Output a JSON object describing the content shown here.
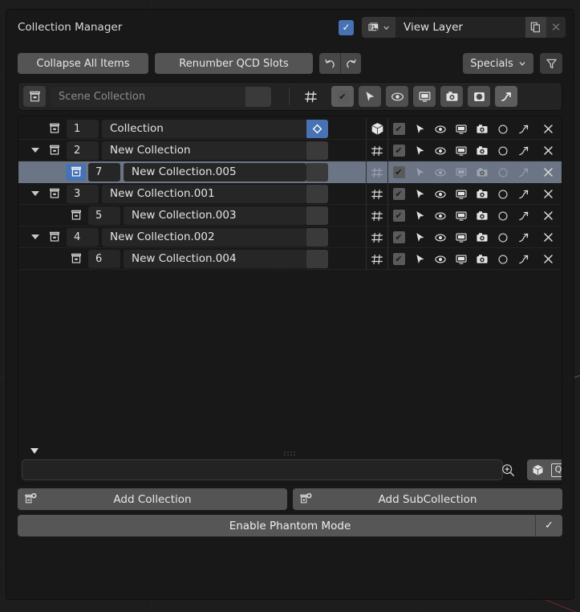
{
  "window": {
    "title": "Collection Manager",
    "enabled_checkbox": true,
    "view_layer": {
      "icon": "render-layers-icon",
      "value": "View Layer",
      "copy_label": "copy-icon",
      "close_label": "✕"
    }
  },
  "toolbar": {
    "collapse_label": "Collapse All Items",
    "renumber_label": "Renumber QCD Slots",
    "undo_icon": "undo-icon",
    "redo_icon": "redo-icon",
    "specials_label": "Specials",
    "filter_icon": "filter-icon"
  },
  "scene_collection": {
    "icon": "collection-icon",
    "name": "Scene Collection",
    "placeholder": "Scene Collection",
    "qcd_icon": "qcd-slot-icon",
    "toggles": [
      {
        "name": "exclude-toggle",
        "icon": "checkbox",
        "on": true
      },
      {
        "name": "selectable-toggle",
        "icon": "cursor",
        "on": false
      },
      {
        "name": "hide-viewport-toggle",
        "icon": "eye",
        "on": false
      },
      {
        "name": "disable-viewport-toggle",
        "icon": "monitor",
        "on": false
      },
      {
        "name": "disable-render-toggle",
        "icon": "camera",
        "on": false
      },
      {
        "name": "holdout-toggle",
        "icon": "holdout",
        "on": false
      },
      {
        "name": "indirect-only-toggle",
        "icon": "indirect",
        "on": true
      }
    ]
  },
  "tree": {
    "rows": [
      {
        "indent": 0,
        "expander": false,
        "number": "1",
        "name": "Collection",
        "icon_active": false,
        "swatch": "blue",
        "row_icon": "object-cube",
        "selected": false,
        "dim": false
      },
      {
        "indent": 0,
        "expander": true,
        "number": "2",
        "name": "New Collection",
        "icon_active": false,
        "swatch": "grey",
        "row_icon": "qcd-slot",
        "selected": false,
        "dim": false
      },
      {
        "indent": 1,
        "expander": false,
        "number": "7",
        "name": "New Collection.005",
        "icon_active": true,
        "swatch": "grey",
        "row_icon": "qcd-slot",
        "selected": true,
        "dim": true
      },
      {
        "indent": 0,
        "expander": true,
        "number": "3",
        "name": "New Collection.001",
        "icon_active": false,
        "swatch": "grey",
        "row_icon": "qcd-slot",
        "selected": false,
        "dim": false
      },
      {
        "indent": 1,
        "expander": false,
        "number": "5",
        "name": "New Collection.003",
        "icon_active": false,
        "swatch": "grey",
        "row_icon": "qcd-slot",
        "selected": false,
        "dim": false
      },
      {
        "indent": 0,
        "expander": true,
        "number": "4",
        "name": "New Collection.002",
        "icon_active": false,
        "swatch": "grey",
        "row_icon": "qcd-slot",
        "selected": false,
        "dim": false
      },
      {
        "indent": 1,
        "expander": false,
        "number": "6",
        "name": "New Collection.004",
        "icon_active": false,
        "swatch": "grey",
        "row_icon": "qcd-slot",
        "selected": false,
        "dim": false
      }
    ],
    "row_toggles": [
      "checkbox",
      "cursor",
      "eye",
      "monitor",
      "camera",
      "holdout",
      "indirect"
    ],
    "remove_label": "✕"
  },
  "bottom_strip": {
    "expander_icon": "triangle-down-icon",
    "grip_icon": "::::",
    "search_value": "",
    "zoom_icon": "zoom-in-icon",
    "cube_icon": "object-cube-icon",
    "q_label": "Q"
  },
  "footer": {
    "add_collection_label": "Add Collection",
    "add_subcollection_label": "Add SubCollection",
    "phantom_label": "Enable Phantom Mode",
    "phantom_checked": "✓"
  },
  "colors": {
    "accent_blue": "#4772b3",
    "selected_row": "#6b7586",
    "panel_bg": "#181818",
    "button_grey": "#545454"
  }
}
